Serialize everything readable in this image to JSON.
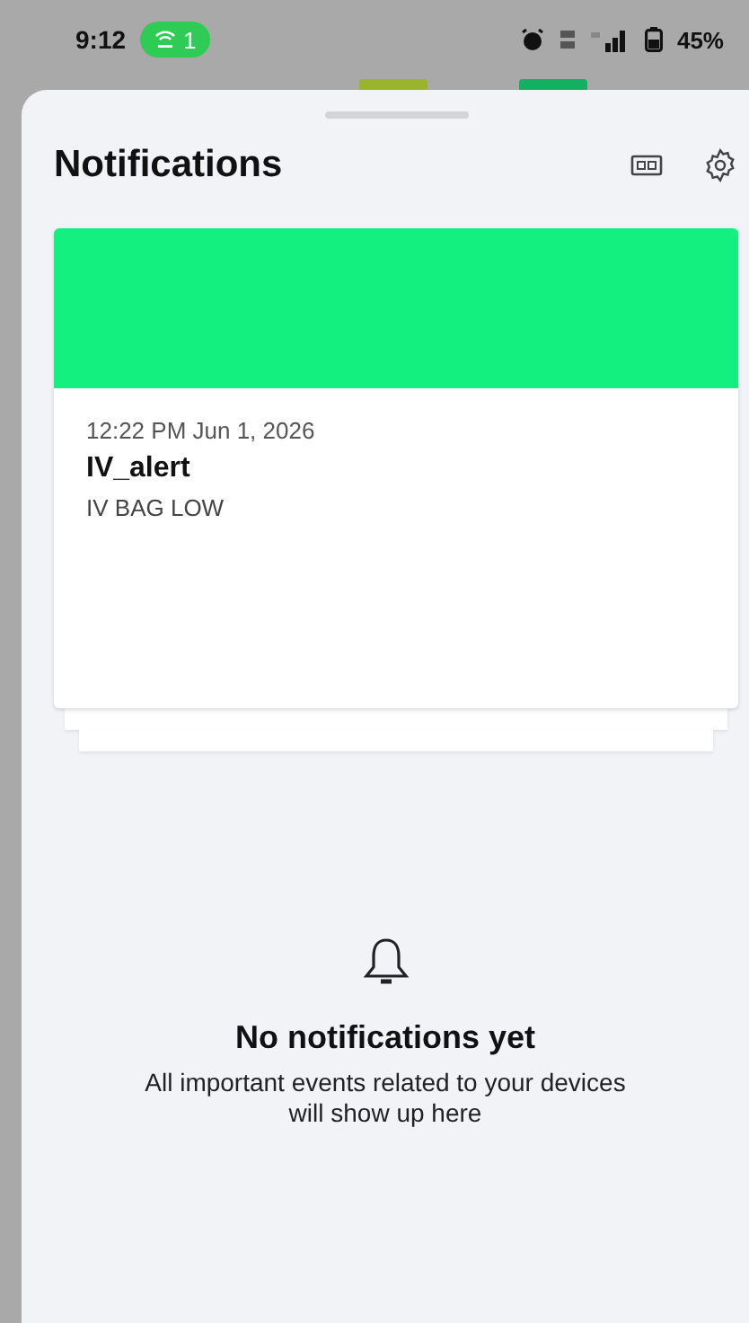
{
  "status_bar": {
    "time": "9:12",
    "hotspot_count": "1",
    "battery": "45%"
  },
  "header": {
    "title": "Notifications"
  },
  "notifications": [
    {
      "time": "12:22 PM Jun 1, 2026",
      "title": "IV_alert",
      "message": "IV BAG LOW",
      "color": "#13f07f"
    }
  ],
  "empty_state": {
    "title": "No notifications yet",
    "description": "All important events related to your devices will show up here"
  }
}
